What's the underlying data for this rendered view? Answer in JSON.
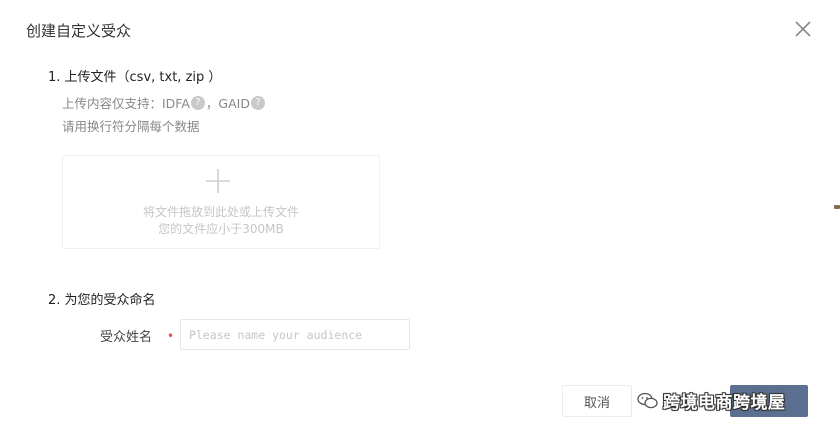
{
  "dialog": {
    "title": "创建自定义受众",
    "close_icon": "close-icon"
  },
  "upload_section": {
    "title": "1. 上传文件（csv, txt, zip ）",
    "hint_prefix": "上传内容仅支持：IDFA",
    "hint_separator": "，GAID",
    "help_icon_glyph": "?",
    "hint_line2": "请用换行符分隔每个数据",
    "dropzone": {
      "icon": "plus-icon",
      "line1": "将文件拖放到此处或上传文件",
      "line2": "您的文件应小于300MB"
    }
  },
  "name_section": {
    "title": "2. 为您的受众命名",
    "field_label": "受众姓名",
    "required_mark": "•",
    "input_value": "",
    "input_placeholder": "Please name your audience"
  },
  "footer": {
    "cancel_label": "取消",
    "confirm_label": ""
  },
  "watermark": {
    "text": "跨境电商跨境屋",
    "icon": "wechat-icon"
  },
  "colors": {
    "primary_button": "#5b6f91",
    "required": "#e35252",
    "hint_text": "#888888",
    "placeholder": "#c6c6c6"
  }
}
